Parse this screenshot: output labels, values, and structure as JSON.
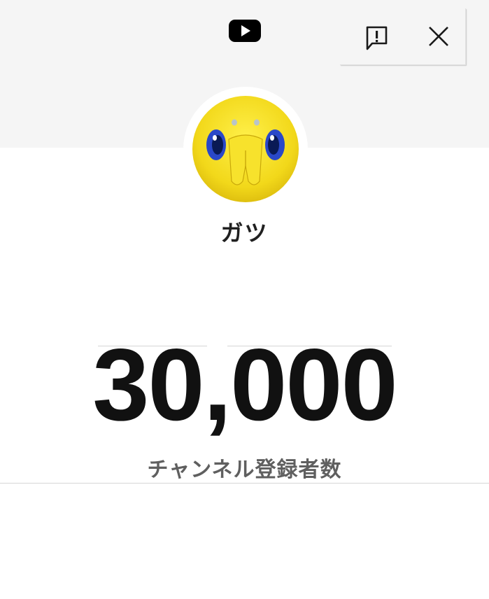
{
  "header": {
    "logo_icon": "youtube-logo-icon",
    "report_icon": "report-feedback-icon",
    "close_icon": "close-icon",
    "background_color": "#f5f5f5"
  },
  "channel": {
    "name": "ガツ",
    "avatar_icon": "yellow-plush-creature-avatar"
  },
  "subscribers": {
    "count": "30,000",
    "label": "チャンネル登録者数"
  },
  "colors": {
    "youtube_red": "#000000",
    "count_text": "#111111",
    "label_text": "#5f5f5f"
  }
}
